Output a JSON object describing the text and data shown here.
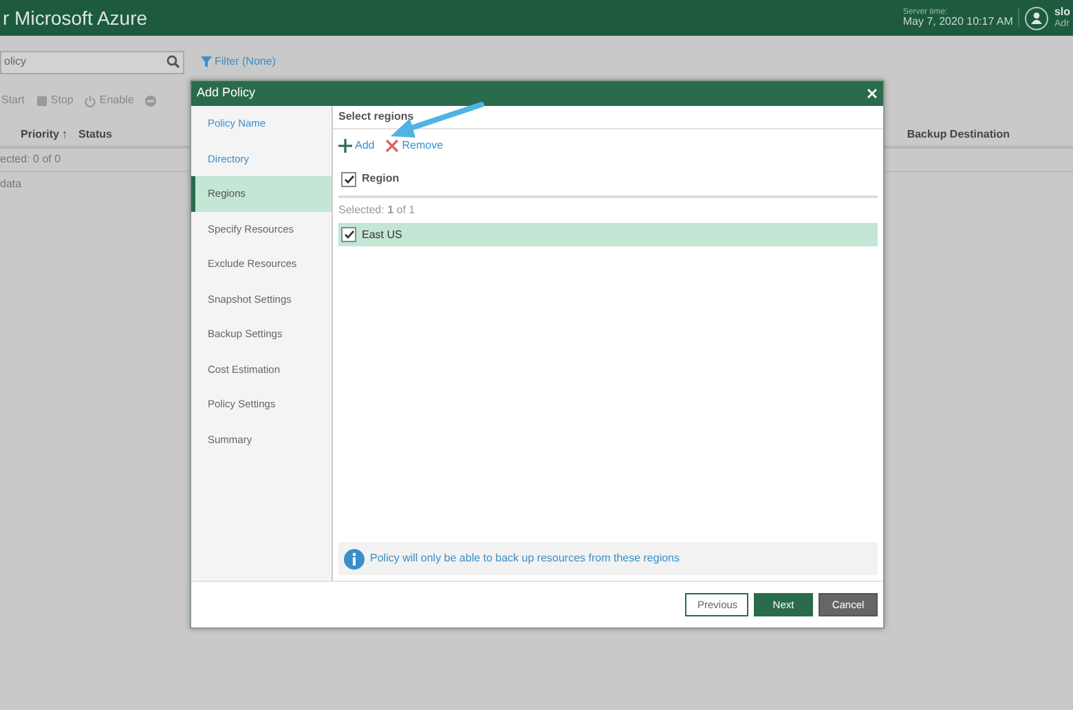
{
  "app": {
    "title": "r Microsoft Azure",
    "server_time_label": "Server time:",
    "server_time": "May 7, 2020 10:17 AM",
    "user_name": "slo",
    "user_role": "Adr"
  },
  "search": {
    "value": "olicy"
  },
  "filter": {
    "label": "Filter (None)"
  },
  "toolbar": [
    {
      "label": "Start",
      "kind": "start"
    },
    {
      "label": "Stop",
      "kind": "stop"
    },
    {
      "label": "Enable",
      "kind": "enable"
    },
    {
      "kind": "disable"
    }
  ],
  "table": {
    "columns": [
      {
        "label": "Priority",
        "sort": "↑"
      },
      {
        "label": "Status"
      },
      {
        "label": "Backup Destination"
      }
    ],
    "selection": "ected:  0 of 0",
    "empty_text": "data"
  },
  "dialog": {
    "title": "Add Policy",
    "steps": [
      {
        "label": "Policy Name",
        "selected": false,
        "visited": true
      },
      {
        "label": "Directory",
        "selected": false,
        "visited": true
      },
      {
        "label": "Regions",
        "selected": true,
        "visited": true
      },
      {
        "label": "Specify Resources",
        "selected": false,
        "visited": false
      },
      {
        "label": "Exclude Resources",
        "selected": false,
        "visited": false
      },
      {
        "label": "Snapshot Settings",
        "selected": false,
        "visited": false
      },
      {
        "label": "Backup Settings",
        "selected": false,
        "visited": false
      },
      {
        "label": "Cost Estimation",
        "selected": false,
        "visited": false
      },
      {
        "label": "Policy Settings",
        "selected": false,
        "visited": false
      },
      {
        "label": "Summary",
        "selected": false,
        "visited": false
      }
    ],
    "section_title": "Select regions",
    "actions": [
      {
        "label": "Add",
        "kind": "add"
      },
      {
        "label": "Remove",
        "kind": "remove"
      }
    ],
    "region_header": {
      "label": "Region",
      "checked": true
    },
    "selection": "Selected:  **1** of 1",
    "rows": [
      {
        "label": "East US",
        "checked": true,
        "selected": true
      }
    ],
    "info": "Policy will only be able to back up resources from these regions",
    "buttons": [
      {
        "label": "Previous",
        "kind": "outline"
      },
      {
        "label": "Next",
        "kind": "primary"
      },
      {
        "label": "Cancel",
        "kind": "secondary"
      }
    ]
  }
}
